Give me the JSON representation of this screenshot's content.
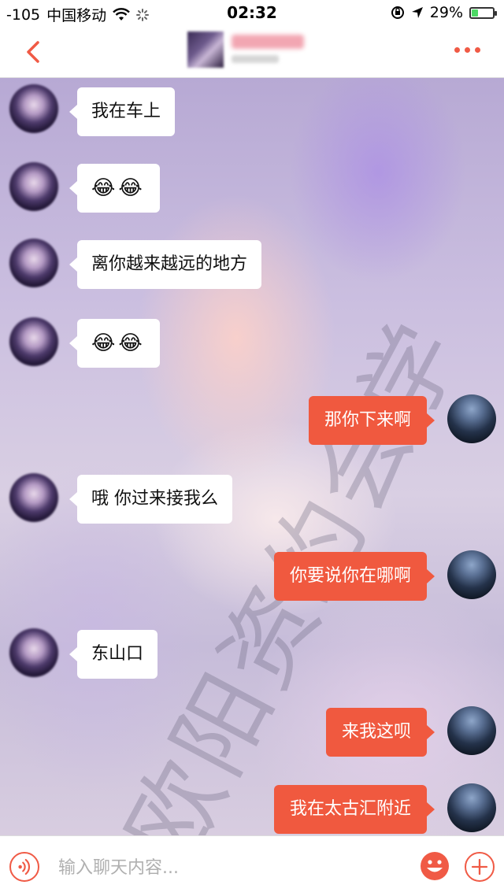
{
  "status_bar": {
    "signal": "-105",
    "carrier": "中国移动",
    "time": "02:32",
    "battery": "29%",
    "battery_level": 0.29
  },
  "nav": {
    "back_icon": "chevron-left-icon",
    "more_icon": "more-dots-icon",
    "accent_color": "#f05a45"
  },
  "messages": [
    {
      "side": "left",
      "text": "我在车上"
    },
    {
      "side": "left",
      "text": "😂😂"
    },
    {
      "side": "left",
      "text": "离你越来越远的地方"
    },
    {
      "side": "left",
      "text": "😂😂"
    },
    {
      "side": "right",
      "text": "那你下来啊"
    },
    {
      "side": "left",
      "text": "哦 你过来接我么"
    },
    {
      "side": "right",
      "text": "你要说你在哪啊"
    },
    {
      "side": "left",
      "text": "东山口"
    },
    {
      "side": "right",
      "text": "来我这呗"
    },
    {
      "side": "right",
      "text": "我在太古汇附近"
    }
  ],
  "watermark": "欧阳资约会学",
  "input": {
    "placeholder": "输入聊天内容..."
  },
  "colors": {
    "outgoing_bubble": "#f0593f",
    "incoming_bubble": "#ffffff"
  }
}
